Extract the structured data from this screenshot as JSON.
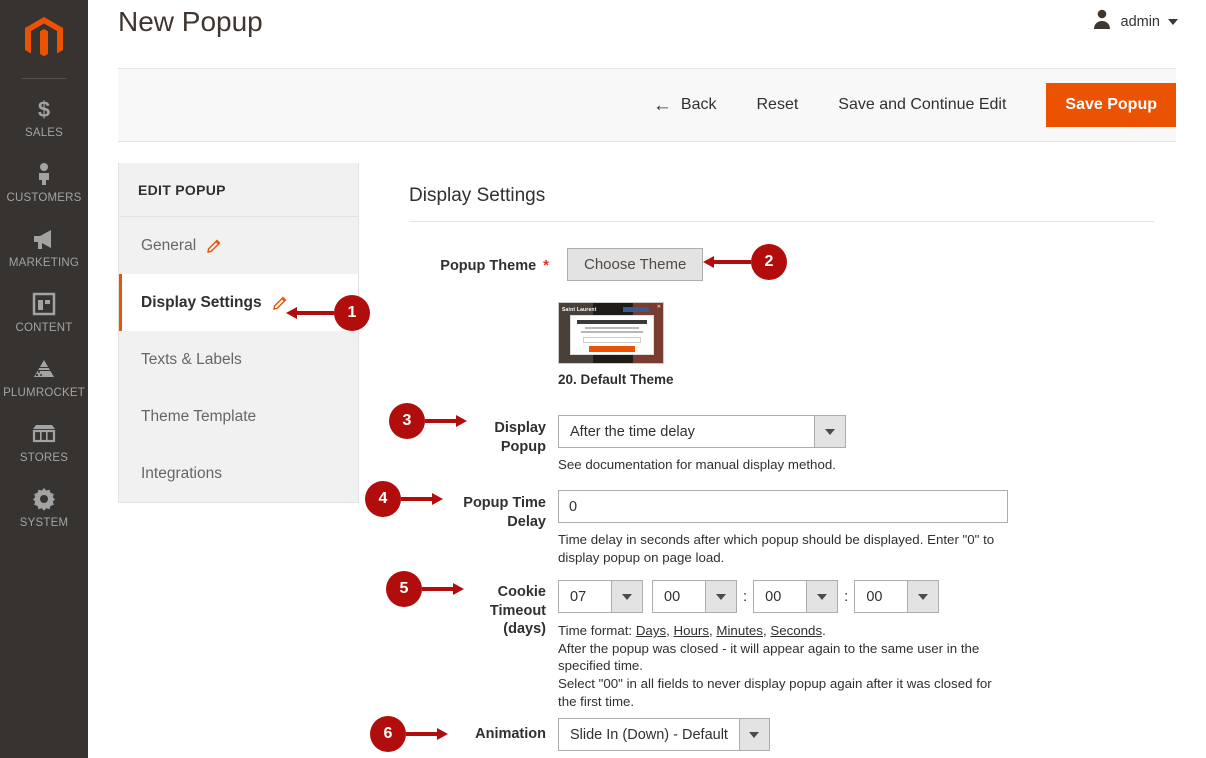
{
  "rail": {
    "logo_icon": "magento-logo-icon",
    "items": [
      {
        "label": "SALES",
        "icon": "dollar-icon"
      },
      {
        "label": "CUSTOMERS",
        "icon": "person-icon"
      },
      {
        "label": "MARKETING",
        "icon": "megaphone-icon"
      },
      {
        "label": "CONTENT",
        "icon": "layout-icon"
      },
      {
        "label": "PLUMROCKET",
        "icon": "plumrocket-icon"
      },
      {
        "label": "STORES",
        "icon": "storefront-icon"
      },
      {
        "label": "SYSTEM",
        "icon": "gear-icon"
      }
    ]
  },
  "header": {
    "title": "New Popup",
    "user_name": "admin",
    "user_icon": "user-avatar-icon",
    "caret_icon": "chevron-down-icon"
  },
  "toolbar": {
    "back_label": "Back",
    "back_icon": "arrow-left-icon",
    "reset_label": "Reset",
    "save_continue_label": "Save and Continue Edit",
    "save_label": "Save Popup",
    "save_color": "#eb5202"
  },
  "edit_nav": {
    "title": "EDIT POPUP",
    "items": [
      {
        "label": "General",
        "pencil": true,
        "active": false
      },
      {
        "label": "Display Settings",
        "pencil": true,
        "active": true
      },
      {
        "label": "Texts & Labels",
        "pencil": false,
        "active": false
      },
      {
        "label": "Theme Template",
        "pencil": false,
        "active": false
      },
      {
        "label": "Integrations",
        "pencil": false,
        "active": false
      }
    ],
    "active_accent": "#eb5202"
  },
  "main": {
    "section_title": "Display Settings",
    "popup_theme": {
      "label": "Popup Theme",
      "required_mark": "*",
      "button_label": "Choose Theme",
      "thumbnail_label": "20. Default Theme",
      "thumbnail_brand": "Saint Laurent",
      "thumbnail_headline": "GET $10 OFF YOUR FIRST ORDER"
    },
    "display_popup": {
      "label_line1": "Display",
      "label_line2": "Popup",
      "value": "After the time delay",
      "note": "See documentation for manual display method."
    },
    "popup_time_delay": {
      "label_line1": "Popup Time",
      "label_line2": "Delay",
      "value": "0",
      "note": "Time delay in seconds after which popup should be displayed. Enter \"0\" to display popup on page load."
    },
    "cookie_timeout": {
      "label_line1": "Cookie",
      "label_line2": "Timeout",
      "label_line3": "(days)",
      "days": "07",
      "hours": "00",
      "minutes": "00",
      "seconds": "00",
      "separator": ":",
      "note_prefix": "Time format: ",
      "note_days": "Days",
      "note_hours": "Hours",
      "note_minutes": "Minutes",
      "note_seconds": "Seconds",
      "note_line2": "After the popup was closed - it will appear again to the same user in the specified time.",
      "note_line3": "Select \"00\" in all fields to never display popup again after it was closed for the first time."
    },
    "animation": {
      "label": "Animation",
      "value": "Slide In (Down) - Default"
    }
  },
  "callouts": {
    "color": "#b20d0d",
    "items": [
      {
        "number": "1",
        "direction": "left"
      },
      {
        "number": "2",
        "direction": "left"
      },
      {
        "number": "3",
        "direction": "right"
      },
      {
        "number": "4",
        "direction": "right"
      },
      {
        "number": "5",
        "direction": "right"
      },
      {
        "number": "6",
        "direction": "right"
      }
    ]
  }
}
